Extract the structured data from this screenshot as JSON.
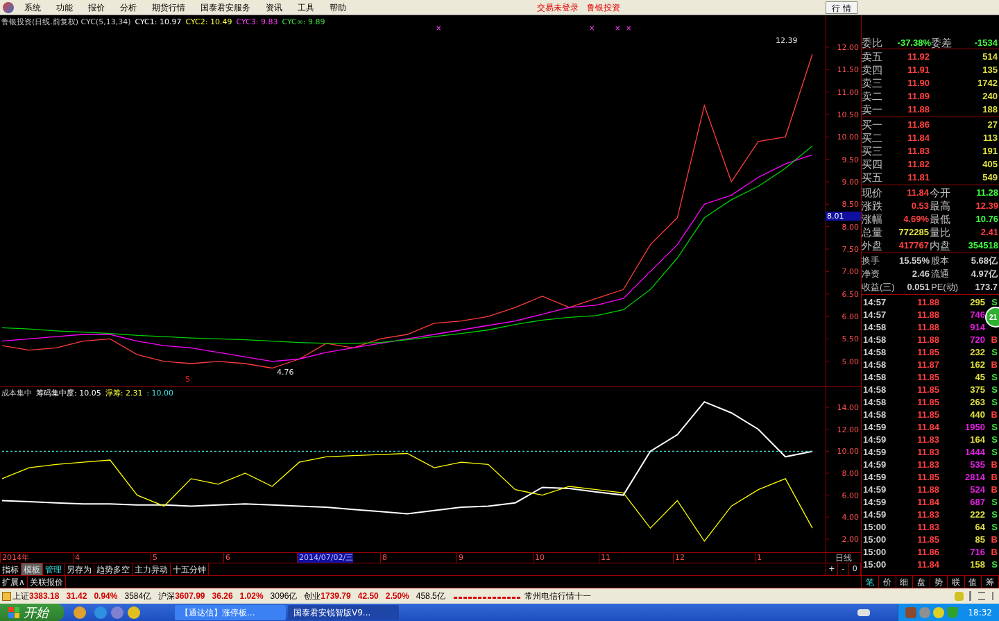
{
  "menu": {
    "items": [
      "系统",
      "功能",
      "报价",
      "分析",
      "期货行情",
      "国泰君安服务",
      "资讯",
      "工具",
      "帮助"
    ],
    "notices": [
      "交易未登录",
      "鲁银投资"
    ],
    "mode_button": "行 情"
  },
  "main_chart": {
    "header": [
      {
        "text": "鲁银投资(日线.前复权) CYC(5,13,34)"
      },
      {
        "text": "CYC1: 10.97",
        "color": "#ffffff"
      },
      {
        "text": "CYC2: 10.49",
        "color": "#ffff40"
      },
      {
        "text": "CYC3: 9.83",
        "color": "#ff40ff"
      },
      {
        "text": "CYC∞: 9.89",
        "color": "#40e040"
      }
    ],
    "markers": [
      "×",
      "×",
      "×",
      "×"
    ],
    "cursor_value": "8.01",
    "chart_data": {
      "type": "line",
      "categories": [
        null,
        null,
        null,
        null,
        null,
        null,
        null,
        null,
        null,
        null,
        null,
        null,
        null,
        null,
        null,
        null,
        null,
        null,
        null,
        null,
        null,
        null,
        null,
        null,
        null,
        null,
        null,
        null,
        null,
        null,
        null
      ],
      "ylim": [
        4.44,
        12.71
      ],
      "yticks": [
        {
          "value": 5,
          "label": "5.00"
        },
        {
          "value": 5.5,
          "label": "5.50"
        },
        {
          "value": 6,
          "label": "6.00"
        },
        {
          "value": 6.5,
          "label": "6.50"
        },
        {
          "value": 7,
          "label": "7.00"
        },
        {
          "value": 7.5,
          "label": "7.50"
        },
        {
          "value": 8,
          "label": "8.00"
        },
        {
          "value": 8.5,
          "label": "8.50"
        },
        {
          "value": 9,
          "label": "9.00"
        },
        {
          "value": 9.5,
          "label": "9.50"
        },
        {
          "value": 10,
          "label": "10.00"
        },
        {
          "value": 10.5,
          "label": "10.50"
        },
        {
          "value": 11,
          "label": "11.00"
        },
        {
          "value": 11.5,
          "label": "11.50"
        },
        {
          "value": 12,
          "label": "12.00"
        }
      ],
      "series": [
        {
          "color": "#ff3c3c",
          "values": [
            5.35,
            5.25,
            5.3,
            5.45,
            5.5,
            5.15,
            5.0,
            4.95,
            5.0,
            4.95,
            4.85,
            5.05,
            5.4,
            5.3,
            5.5,
            5.6,
            5.85,
            5.9,
            6.0,
            6.2,
            6.45,
            6.2,
            6.4,
            6.6,
            7.6,
            8.2,
            10.7,
            9.0,
            9.9,
            10.0,
            11.84
          ]
        },
        {
          "color": "#ff00ff",
          "values": [
            5.45,
            5.5,
            5.55,
            5.6,
            5.6,
            5.45,
            5.35,
            5.3,
            5.2,
            5.1,
            5.0,
            5.05,
            5.2,
            5.3,
            5.4,
            5.5,
            5.6,
            5.7,
            5.8,
            5.9,
            6.05,
            6.2,
            6.25,
            6.4,
            7.0,
            7.6,
            8.5,
            8.7,
            9.1,
            9.4,
            9.6
          ]
        },
        {
          "color": "#00d000",
          "values": [
            5.75,
            5.72,
            5.68,
            5.65,
            5.62,
            5.58,
            5.55,
            5.52,
            5.5,
            5.48,
            5.45,
            5.42,
            5.4,
            5.4,
            5.42,
            5.48,
            5.55,
            5.62,
            5.7,
            5.82,
            5.92,
            5.98,
            6.02,
            6.15,
            6.6,
            7.3,
            8.2,
            8.6,
            8.9,
            9.3,
            9.8
          ]
        }
      ],
      "annotations": [
        {
          "text": "12.39"
        },
        {
          "text": "4.76"
        },
        {
          "text": "S"
        }
      ]
    }
  },
  "indicator_chart": {
    "header": [
      {
        "text": "成本集中"
      },
      {
        "text": "筹码集中度: 10.05",
        "color": "#ffffff"
      },
      {
        "text": "浮筹: 2.31",
        "color": "#ffff40"
      },
      {
        "text": ": 10.00",
        "color": "#40e0e0"
      }
    ],
    "chart_data": {
      "type": "line",
      "categories": [
        null,
        null,
        null,
        null,
        null,
        null,
        null,
        null,
        null,
        null,
        null,
        null,
        null,
        null,
        null,
        null,
        null,
        null,
        null,
        null,
        null,
        null,
        null,
        null,
        null,
        null,
        null,
        null,
        null,
        null,
        null
      ],
      "ylim": [
        0.79,
        15.84
      ],
      "yticks": [
        {
          "value": 2,
          "label": "2.00"
        },
        {
          "value": 4,
          "label": "4.00"
        },
        {
          "value": 6,
          "label": "6.00"
        },
        {
          "value": 8,
          "label": "8.00"
        },
        {
          "value": 10,
          "label": "10.00"
        },
        {
          "value": 12,
          "label": "12.00"
        },
        {
          "value": 14,
          "label": "14.00"
        }
      ],
      "series": [
        {
          "color": "#ffffff",
          "values": [
            5.5,
            5.4,
            5.3,
            5.2,
            5.2,
            5.1,
            5.1,
            5.0,
            5.1,
            5.2,
            5.1,
            5.0,
            4.9,
            4.7,
            4.5,
            4.3,
            4.6,
            4.9,
            5.0,
            5.3,
            6.7,
            6.6,
            6.3,
            6.0,
            10.0,
            11.5,
            14.5,
            13.5,
            12.0,
            9.5,
            10.0
          ]
        },
        {
          "color": "#ffff00",
          "values": [
            7.5,
            8.5,
            8.8,
            9.0,
            9.2,
            6.0,
            5.0,
            7.5,
            7.0,
            8.0,
            6.8,
            9.0,
            9.5,
            9.6,
            9.7,
            9.8,
            8.5,
            9.0,
            8.8,
            6.5,
            6.0,
            6.8,
            6.5,
            6.2,
            3.0,
            5.5,
            1.8,
            5.0,
            6.5,
            7.5,
            3.0
          ]
        },
        {
          "color": "#40e0e0",
          "line_style": "dashed",
          "values": [
            10,
            10,
            10,
            10,
            10,
            10,
            10,
            10,
            10,
            10,
            10,
            10,
            10,
            10,
            10,
            10,
            10,
            10,
            10,
            10,
            10,
            10,
            10,
            10,
            10,
            10,
            10,
            10,
            10,
            10,
            10
          ]
        }
      ]
    }
  },
  "time_axis": [
    {
      "label": "2014年",
      "highlighted": false
    },
    {
      "label": "4",
      "highlighted": false
    },
    {
      "label": "5",
      "highlighted": false
    },
    {
      "label": "6",
      "highlighted": false
    },
    {
      "label": "2014/07/02/三",
      "highlighted": true
    },
    {
      "label": "8",
      "highlighted": false
    },
    {
      "label": "9",
      "highlighted": false
    },
    {
      "label": "10",
      "highlighted": false
    },
    {
      "label": "11",
      "highlighted": false
    },
    {
      "label": "12",
      "highlighted": false
    },
    {
      "label": "1",
      "highlighted": false
    }
  ],
  "period_label": "日线",
  "zoom_buttons": [
    "+",
    "-",
    "0"
  ],
  "tabs": [
    {
      "label": "指标",
      "selected": false,
      "kind": "normal"
    },
    {
      "label": "模板",
      "selected": true,
      "kind": "normal"
    },
    {
      "label": "管理",
      "selected": false,
      "kind": "accent"
    },
    {
      "label": "另存为",
      "selected": false,
      "kind": "normal"
    },
    {
      "label": "趋势多空",
      "selected": false,
      "kind": "normal"
    },
    {
      "label": "主力异动",
      "selected": false,
      "kind": "normal"
    },
    {
      "label": "十五分钟",
      "selected": false,
      "kind": "normal"
    }
  ],
  "tabs2": [
    "扩展∧",
    "关联报价"
  ],
  "quote": {
    "ratio": {
      "label": "委比",
      "value": "-37.38%",
      "label2": "委差",
      "value2": "-1534"
    },
    "asks": [
      {
        "label": "卖五",
        "price": "11.92",
        "volume": "514"
      },
      {
        "label": "卖四",
        "price": "11.91",
        "volume": "135"
      },
      {
        "label": "卖三",
        "price": "11.90",
        "volume": "1742"
      },
      {
        "label": "卖二",
        "price": "11.89",
        "volume": "240"
      },
      {
        "label": "卖一",
        "price": "11.88",
        "volume": "188"
      }
    ],
    "bids": [
      {
        "label": "买一",
        "price": "11.86",
        "volume": "27"
      },
      {
        "label": "买二",
        "price": "11.84",
        "volume": "113"
      },
      {
        "label": "买三",
        "price": "11.83",
        "volume": "191"
      },
      {
        "label": "买四",
        "price": "11.82",
        "volume": "405"
      },
      {
        "label": "买五",
        "price": "11.81",
        "volume": "549"
      }
    ],
    "stats": [
      {
        "label": "现价",
        "value": "11.84",
        "color": "#ff4040"
      },
      {
        "label": "今开",
        "value": "11.28",
        "color": "#40ff40"
      },
      {
        "label": "涨跌",
        "value": "0.53",
        "color": "#ff4040"
      },
      {
        "label": "最高",
        "value": "12.39",
        "color": "#ff4040"
      },
      {
        "label": "涨幅",
        "value": "4.69%",
        "color": "#ff4040"
      },
      {
        "label": "最低",
        "value": "10.76",
        "color": "#40ff40"
      },
      {
        "label": "总量",
        "value": "772285",
        "color": "#e0e040"
      },
      {
        "label": "量比",
        "value": "2.41",
        "color": "#ff4040"
      },
      {
        "label": "外盘",
        "value": "417767",
        "color": "#ff4040"
      },
      {
        "label": "内盘",
        "value": "354518",
        "color": "#40ff40"
      }
    ],
    "info": [
      {
        "label": "换手",
        "value": "15.55%",
        "label2": "股本",
        "value2": "5.68亿"
      },
      {
        "label": "净资",
        "value": "2.46",
        "label2": "流通",
        "value2": "4.97亿"
      },
      {
        "label": "收益(三)",
        "value": "0.051",
        "label2": "PE(动)",
        "value2": "173.7"
      }
    ]
  },
  "trades": [
    {
      "time": "14:57",
      "price": "11.88",
      "volume": "295",
      "large": false,
      "side": "S"
    },
    {
      "time": "14:57",
      "price": "11.88",
      "volume": "746",
      "large": true
    },
    {
      "time": "14:58",
      "price": "11.88",
      "volume": "914",
      "large": true
    },
    {
      "time": "14:58",
      "price": "11.88",
      "volume": "720",
      "large": true,
      "side": "B"
    },
    {
      "time": "14:58",
      "price": "11.85",
      "volume": "232",
      "large": false,
      "side": "S"
    },
    {
      "time": "14:58",
      "price": "11.87",
      "volume": "162",
      "large": false,
      "side": "B"
    },
    {
      "time": "14:58",
      "price": "11.85",
      "volume": "45",
      "large": false,
      "side": "S"
    },
    {
      "time": "14:58",
      "price": "11.85",
      "volume": "375",
      "large": false,
      "side": "S"
    },
    {
      "time": "14:58",
      "price": "11.85",
      "volume": "263",
      "large": false,
      "side": "S"
    },
    {
      "time": "14:58",
      "price": "11.85",
      "volume": "440",
      "large": false,
      "side": "B"
    },
    {
      "time": "14:59",
      "price": "11.84",
      "volume": "1950",
      "large": true,
      "side": "S"
    },
    {
      "time": "14:59",
      "price": "11.83",
      "volume": "164",
      "large": false,
      "side": "S"
    },
    {
      "time": "14:59",
      "price": "11.83",
      "volume": "1444",
      "large": true,
      "side": "S"
    },
    {
      "time": "14:59",
      "price": "11.83",
      "volume": "535",
      "large": true,
      "side": "B"
    },
    {
      "time": "14:59",
      "price": "11.85",
      "volume": "2814",
      "large": true,
      "side": "B"
    },
    {
      "time": "14:59",
      "price": "11.88",
      "volume": "524",
      "large": true,
      "side": "B"
    },
    {
      "time": "14:59",
      "price": "11.84",
      "volume": "687",
      "large": true,
      "side": "S"
    },
    {
      "time": "14:59",
      "price": "11.83",
      "volume": "222",
      "large": false,
      "side": "S"
    },
    {
      "time": "15:00",
      "price": "11.83",
      "volume": "64",
      "large": false,
      "side": "S"
    },
    {
      "time": "15:00",
      "price": "11.85",
      "volume": "85",
      "large": false,
      "side": "B"
    },
    {
      "time": "15:00",
      "price": "11.86",
      "volume": "716",
      "large": true,
      "side": "B"
    },
    {
      "time": "15:00",
      "price": "11.84",
      "volume": "158",
      "large": false,
      "side": "S"
    }
  ],
  "floating_badge": "21",
  "panel_tabs": [
    {
      "label": "笔",
      "selected": true
    },
    {
      "label": "价",
      "selected": false
    },
    {
      "label": "细",
      "selected": false
    },
    {
      "label": "盘",
      "selected": false
    },
    {
      "label": "势",
      "selected": false
    },
    {
      "label": "联",
      "selected": false
    },
    {
      "label": "值",
      "selected": false
    },
    {
      "label": "筹",
      "selected": false
    }
  ],
  "status_bar": {
    "indices": [
      {
        "name": "上证",
        "value": "3383.18",
        "change": "31.42",
        "percent": "0.94%",
        "amount": "3584亿"
      },
      {
        "name": "沪深",
        "value": "3607.99",
        "change": "36.26",
        "percent": "1.02%",
        "amount": "3096亿"
      },
      {
        "name": "创业",
        "value": "1739.79",
        "change": "42.50",
        "percent": "2.50%",
        "amount": "458.5亿"
      }
    ],
    "server": "常州电信行情十一"
  },
  "taskbar": {
    "start": "开始",
    "tasks": [
      {
        "label": "【通达信】涨停板...",
        "selected": false
      },
      {
        "label": "国泰君安锐智版V9...",
        "selected": true
      }
    ],
    "clock": "18:32"
  }
}
